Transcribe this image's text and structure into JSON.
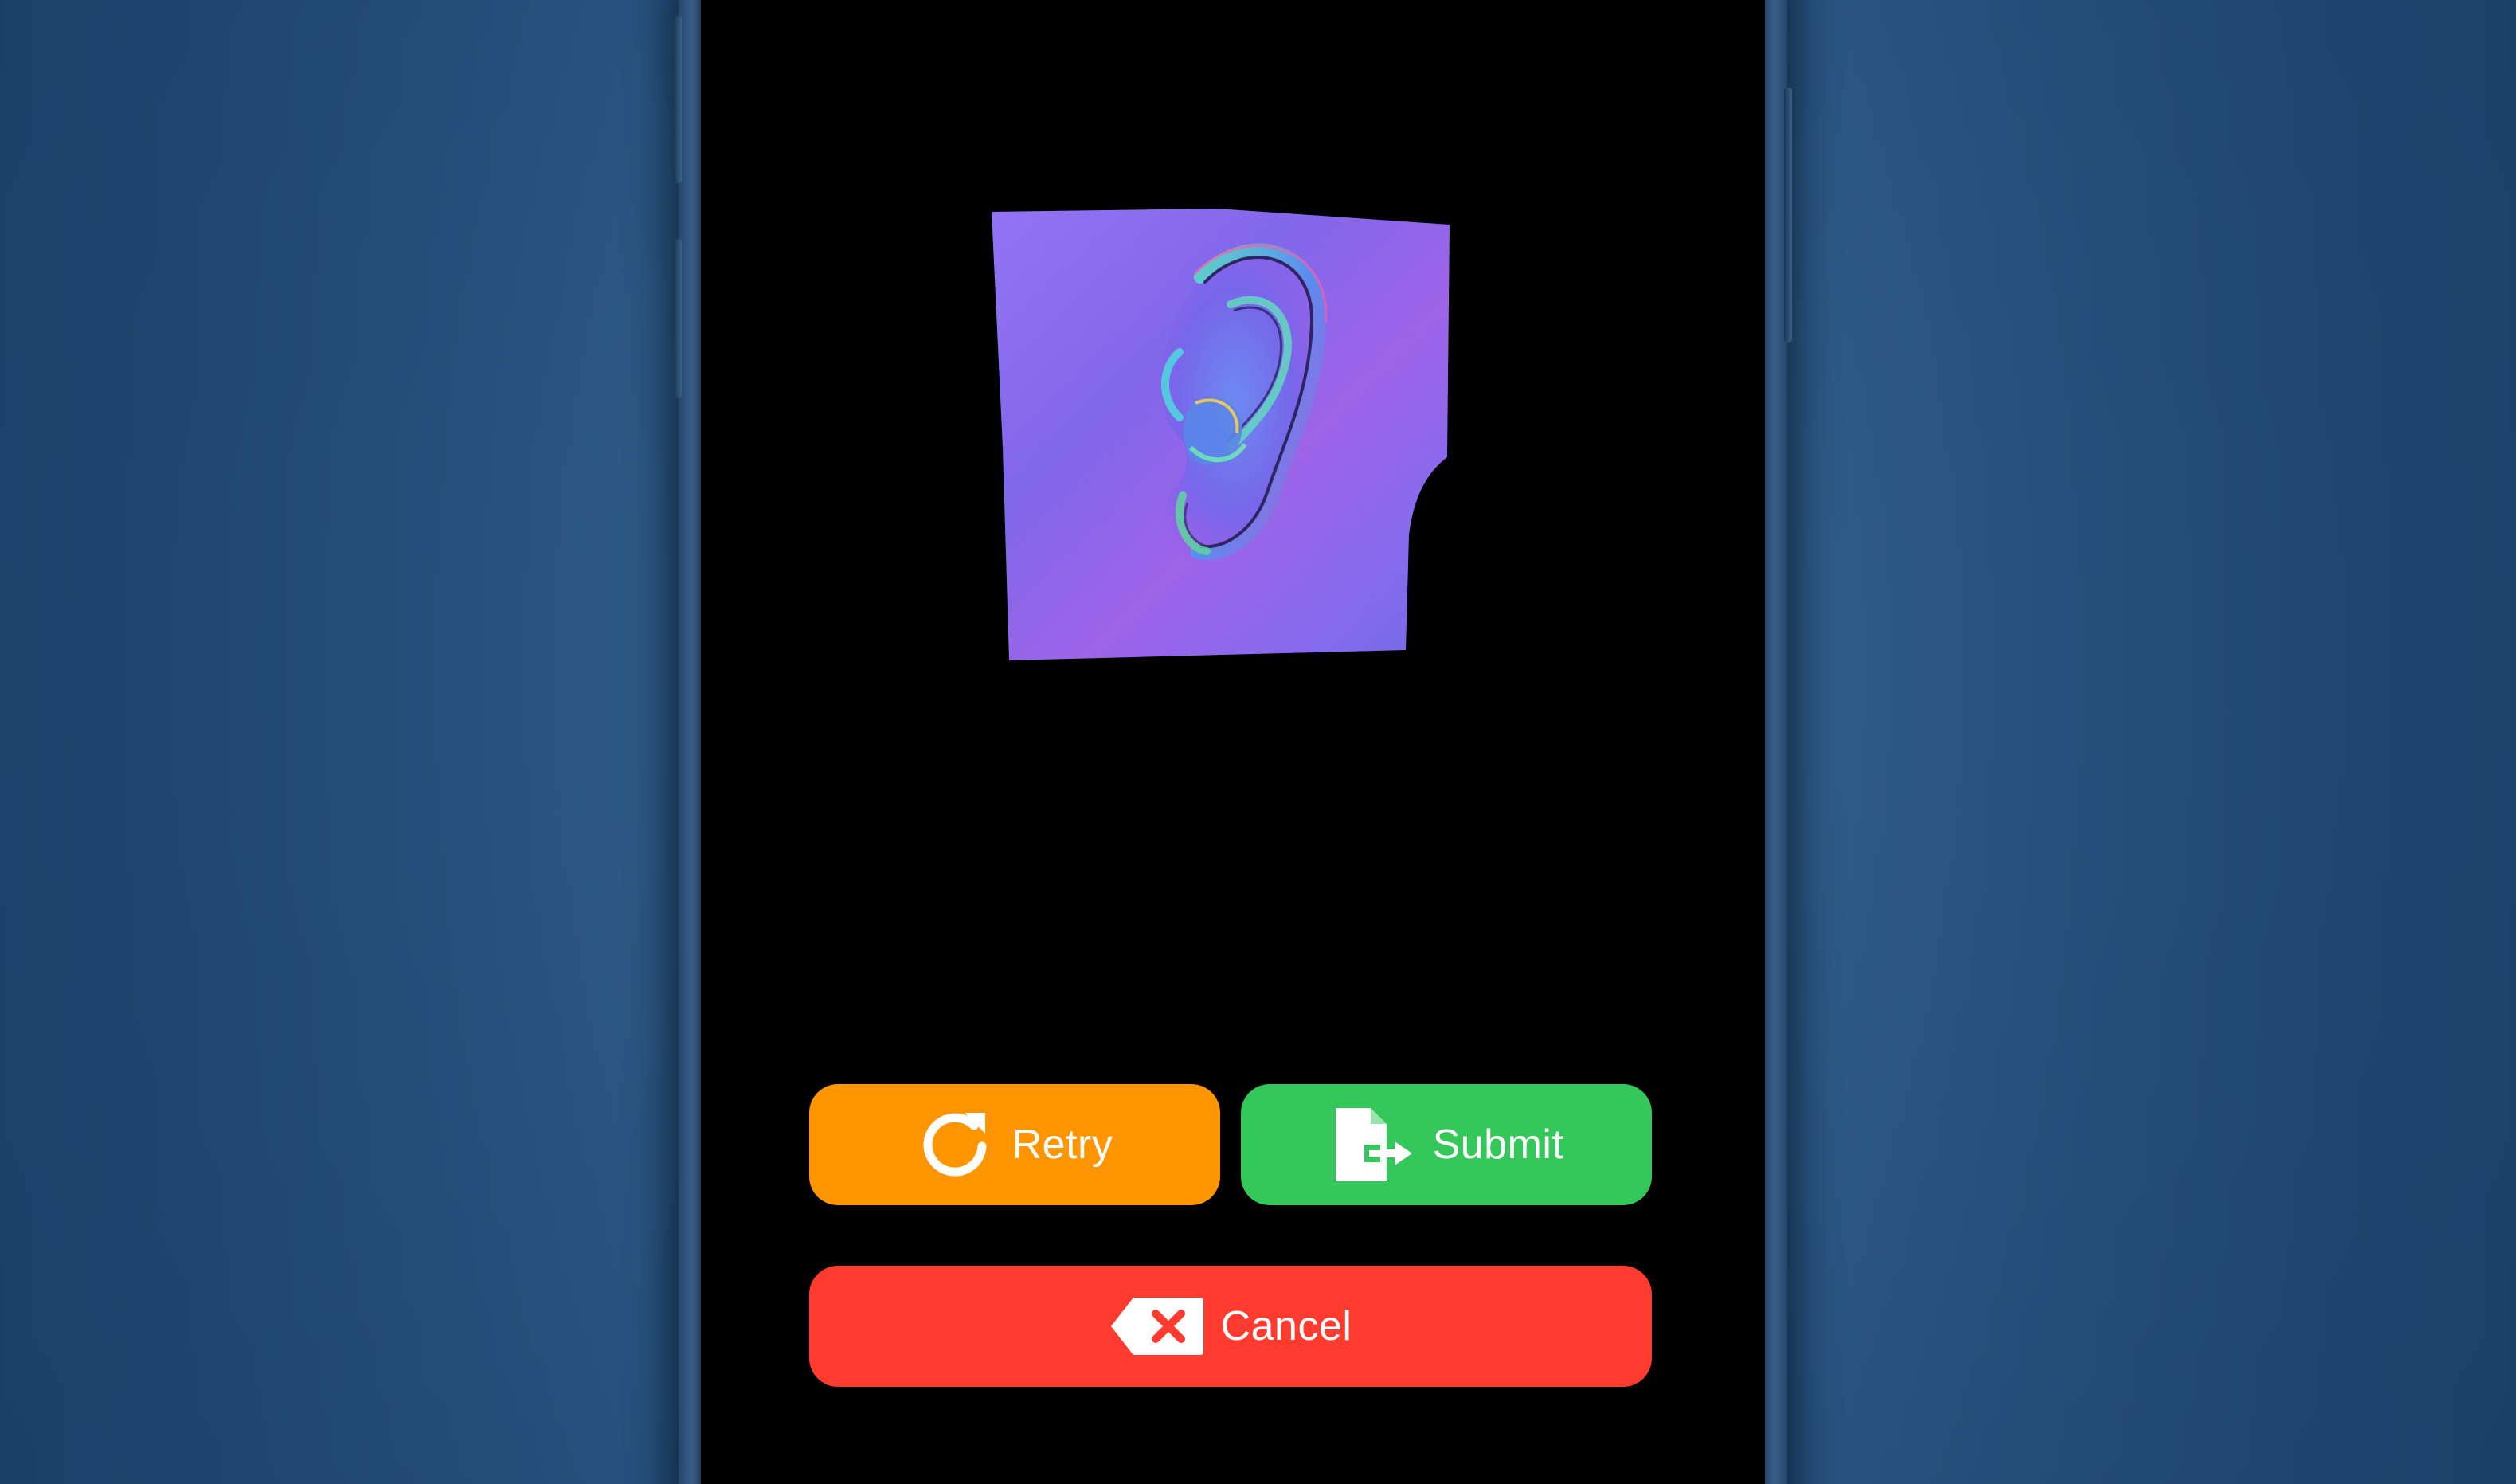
{
  "background": {
    "color_center": "#3d6a97",
    "color_edge": "#1d4670"
  },
  "screen": {
    "background": "#000000",
    "preview": {
      "icon": "ear-scan-normal-map",
      "colors": [
        "#7b6cf0",
        "#a35be6",
        "#58b8d8",
        "#5fd3a0"
      ]
    }
  },
  "actions": {
    "retry": {
      "label": "Retry",
      "icon": "retry-icon",
      "color": "#ff9500"
    },
    "submit": {
      "label": "Submit",
      "icon": "submit-document-icon",
      "color": "#34c759"
    },
    "cancel": {
      "label": "Cancel",
      "icon": "cancel-delete-icon",
      "color": "#ff3b30"
    }
  }
}
